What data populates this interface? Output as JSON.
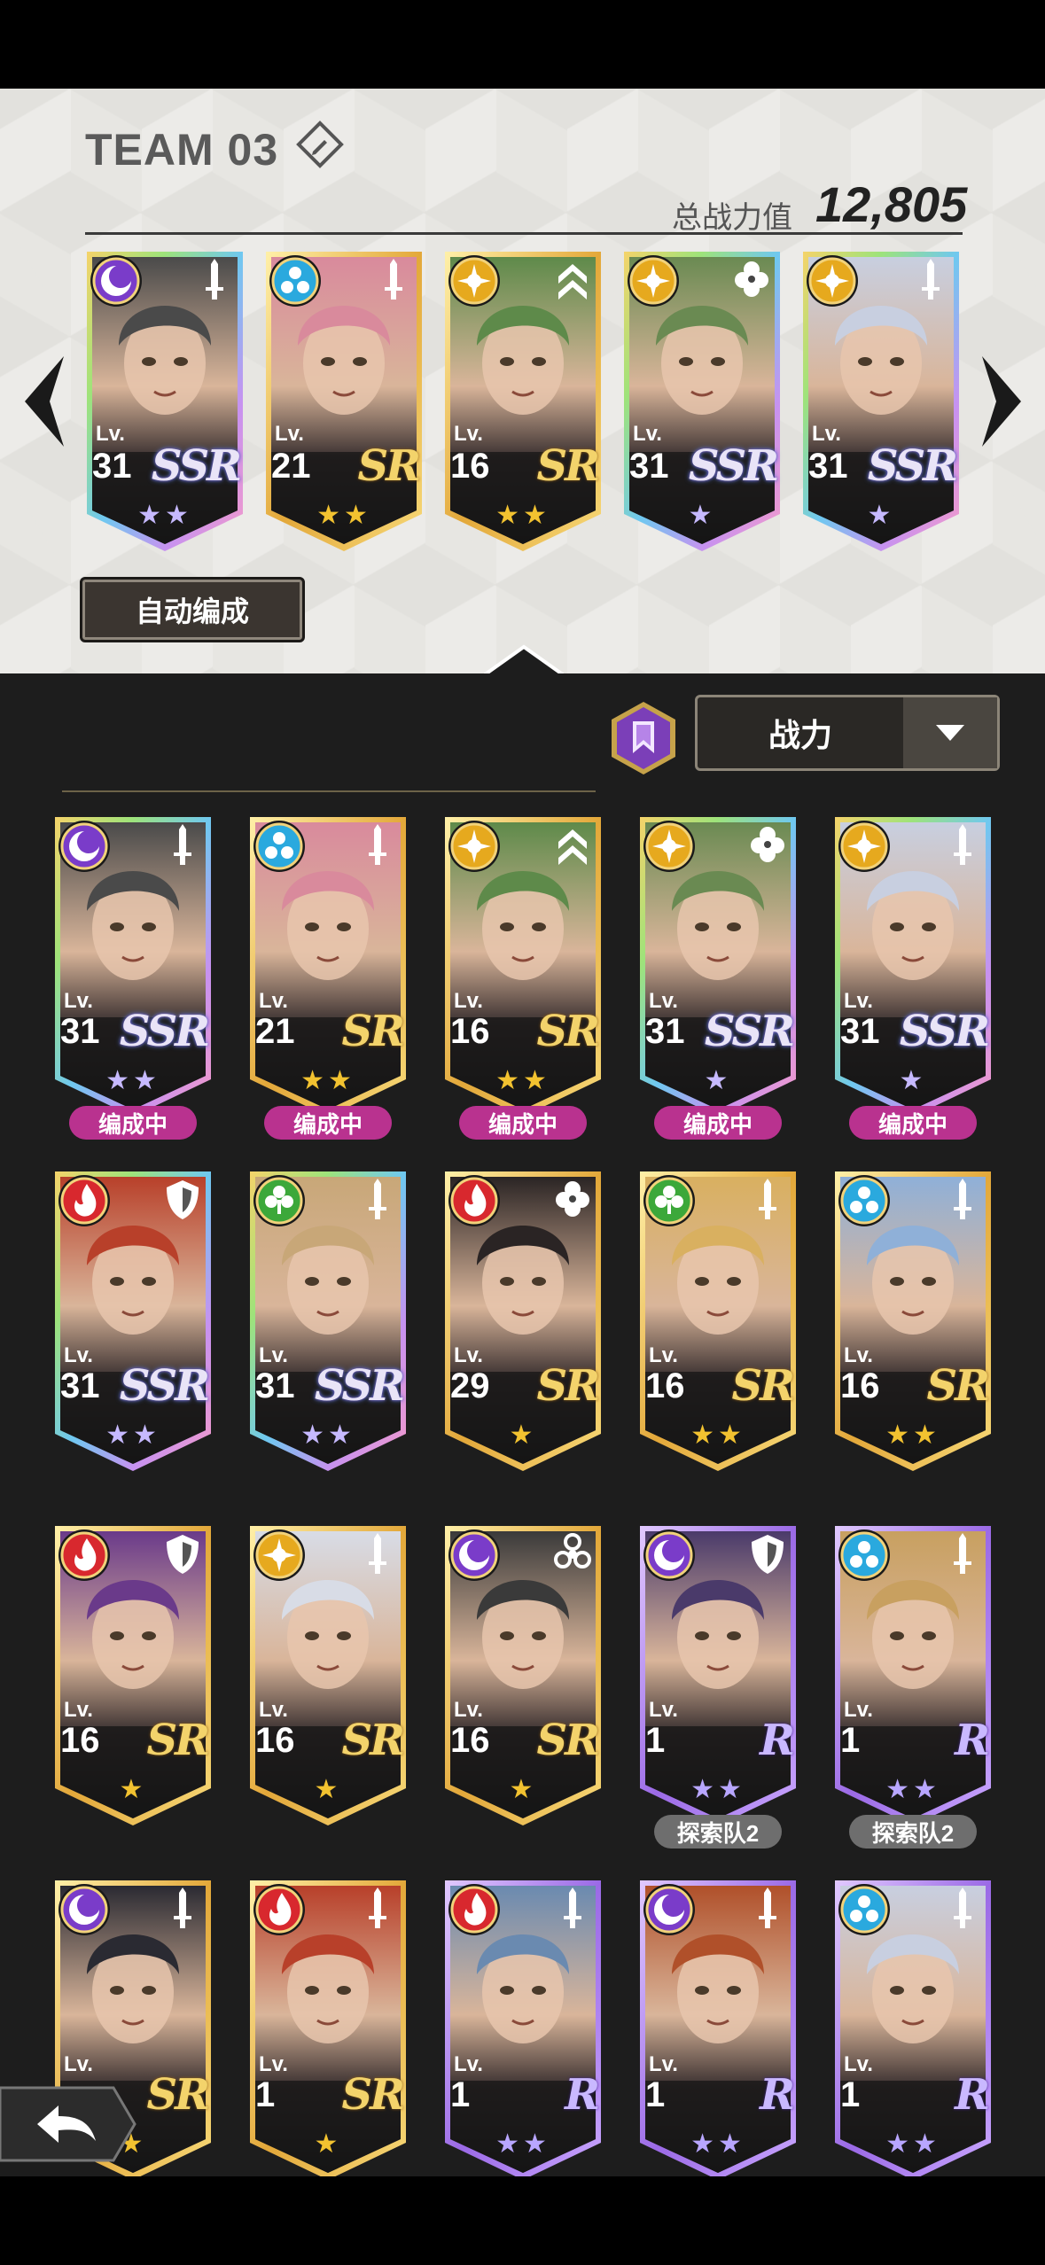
{
  "team": {
    "title": "TEAM 03",
    "power_label": "总战力值",
    "power_value": "12,805",
    "auto_button": "自动编成",
    "members": [
      {
        "lv_label": "Lv.",
        "level": "31",
        "rarity": "SSR",
        "stars": "★★",
        "element": "dark",
        "role": "sword",
        "frame": "rainbow",
        "hair": "#4a4a4a"
      },
      {
        "lv_label": "Lv.",
        "level": "21",
        "rarity": "SR",
        "stars": "★★",
        "element": "water",
        "role": "sword",
        "frame": "gold",
        "hair": "#d98a9c"
      },
      {
        "lv_label": "Lv.",
        "level": "16",
        "rarity": "SR",
        "stars": "★★",
        "element": "light",
        "role": "chevron",
        "frame": "gold",
        "hair": "#5e8a4a"
      },
      {
        "lv_label": "Lv.",
        "level": "31",
        "rarity": "SSR",
        "stars": "★",
        "element": "light",
        "role": "clover",
        "frame": "rainbow",
        "hair": "#6a8a52"
      },
      {
        "lv_label": "Lv.",
        "level": "31",
        "rarity": "SSR",
        "stars": "★",
        "element": "light",
        "role": "sword",
        "frame": "rainbow",
        "hair": "#c8cfe0"
      }
    ]
  },
  "sort": {
    "label": "战力"
  },
  "roster": [
    {
      "lv_label": "Lv.",
      "level": "31",
      "rarity": "SSR",
      "stars": "★★",
      "element": "dark",
      "role": "sword",
      "frame": "rainbow",
      "hair": "#4a4a4a",
      "tag": "编成中",
      "tag_type": "in"
    },
    {
      "lv_label": "Lv.",
      "level": "21",
      "rarity": "SR",
      "stars": "★★",
      "element": "water",
      "role": "sword",
      "frame": "gold",
      "hair": "#d98a9c",
      "tag": "编成中",
      "tag_type": "in"
    },
    {
      "lv_label": "Lv.",
      "level": "16",
      "rarity": "SR",
      "stars": "★★",
      "element": "light",
      "role": "chevron",
      "frame": "gold",
      "hair": "#5e8a4a",
      "tag": "编成中",
      "tag_type": "in"
    },
    {
      "lv_label": "Lv.",
      "level": "31",
      "rarity": "SSR",
      "stars": "★",
      "element": "light",
      "role": "clover",
      "frame": "rainbow",
      "hair": "#6a8a52",
      "tag": "编成中",
      "tag_type": "in"
    },
    {
      "lv_label": "Lv.",
      "level": "31",
      "rarity": "SSR",
      "stars": "★",
      "element": "light",
      "role": "sword",
      "frame": "rainbow",
      "hair": "#c8cfe0",
      "tag": "编成中",
      "tag_type": "in"
    },
    {
      "lv_label": "Lv.",
      "level": "31",
      "rarity": "SSR",
      "stars": "★★",
      "element": "fire",
      "role": "shield",
      "frame": "rainbow",
      "hair": "#b8402a",
      "tag": "",
      "tag_type": ""
    },
    {
      "lv_label": "Lv.",
      "level": "31",
      "rarity": "SSR",
      "stars": "★★",
      "element": "grass",
      "role": "sword",
      "frame": "rainbow",
      "hair": "#c8a778",
      "tag": "",
      "tag_type": ""
    },
    {
      "lv_label": "Lv.",
      "level": "29",
      "rarity": "SR",
      "stars": "★",
      "element": "fire",
      "role": "clover",
      "frame": "gold",
      "hair": "#2a2424",
      "tag": "",
      "tag_type": ""
    },
    {
      "lv_label": "Lv.",
      "level": "16",
      "rarity": "SR",
      "stars": "★★",
      "element": "grass",
      "role": "sword",
      "frame": "gold",
      "hair": "#d9b060",
      "tag": "",
      "tag_type": ""
    },
    {
      "lv_label": "Lv.",
      "level": "16",
      "rarity": "SR",
      "stars": "★★",
      "element": "water",
      "role": "sword",
      "frame": "gold",
      "hair": "#8fb0d8",
      "tag": "",
      "tag_type": ""
    },
    {
      "lv_label": "Lv.",
      "level": "16",
      "rarity": "SR",
      "stars": "★",
      "element": "fire",
      "role": "shield",
      "frame": "gold",
      "hair": "#6a3a8a",
      "tag": "",
      "tag_type": ""
    },
    {
      "lv_label": "Lv.",
      "level": "16",
      "rarity": "SR",
      "stars": "★",
      "element": "light",
      "role": "sword",
      "frame": "gold",
      "hair": "#d8dce6",
      "tag": "",
      "tag_type": ""
    },
    {
      "lv_label": "Lv.",
      "level": "16",
      "rarity": "SR",
      "stars": "★",
      "element": "dark",
      "role": "biohazard",
      "frame": "gold",
      "hair": "#3a3a3a",
      "tag": "",
      "tag_type": ""
    },
    {
      "lv_label": "Lv.",
      "level": "1",
      "rarity": "R",
      "stars": "★★",
      "element": "dark",
      "role": "shield",
      "frame": "purple",
      "hair": "#4a3a6a",
      "tag": "探索队2",
      "tag_type": "explore"
    },
    {
      "lv_label": "Lv.",
      "level": "1",
      "rarity": "R",
      "stars": "★★",
      "element": "water",
      "role": "sword",
      "frame": "purple",
      "hair": "#c8a060",
      "tag": "探索队2",
      "tag_type": "explore"
    },
    {
      "lv_label": "Lv.",
      "level": "",
      "rarity": "SR",
      "stars": "★",
      "element": "dark",
      "role": "sword",
      "frame": "gold",
      "hair": "#2a2a32",
      "tag": "",
      "tag_type": ""
    },
    {
      "lv_label": "Lv.",
      "level": "1",
      "rarity": "SR",
      "stars": "★",
      "element": "fire",
      "role": "sword",
      "frame": "gold",
      "hair": "#b8402a",
      "tag": "",
      "tag_type": ""
    },
    {
      "lv_label": "Lv.",
      "level": "1",
      "rarity": "R",
      "stars": "★★",
      "element": "fire",
      "role": "sword",
      "frame": "purple",
      "hair": "#6a8ab0",
      "tag": "",
      "tag_type": ""
    },
    {
      "lv_label": "Lv.",
      "level": "1",
      "rarity": "R",
      "stars": "★★",
      "element": "dark",
      "role": "sword",
      "frame": "purple",
      "hair": "#b0502a",
      "tag": "",
      "tag_type": ""
    },
    {
      "lv_label": "Lv.",
      "level": "1",
      "rarity": "R",
      "stars": "★★",
      "element": "water",
      "role": "sword",
      "frame": "purple",
      "hair": "#c8cfe0",
      "tag": "",
      "tag_type": ""
    }
  ]
}
